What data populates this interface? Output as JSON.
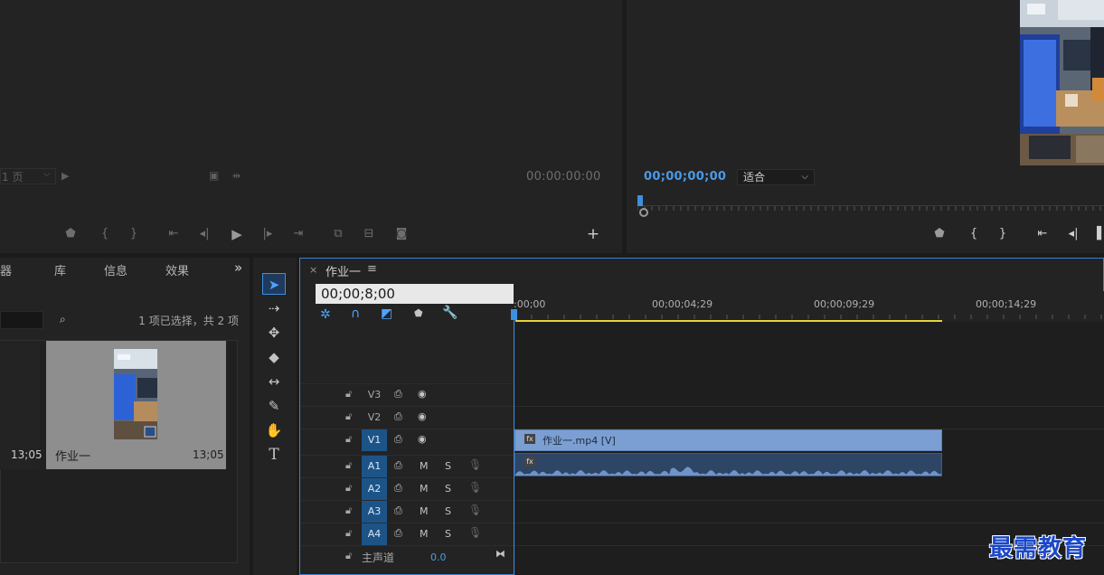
{
  "source_monitor": {
    "page_selector": "1 页",
    "timecode": "00:00:00:00"
  },
  "program_monitor": {
    "timecode": "00;00;00;00",
    "fit_label": "适合"
  },
  "project_panel": {
    "tabs": [
      "器",
      "库",
      "信息",
      "效果"
    ],
    "overflow": "»",
    "selection_info": "1 项已选择，共 2 项",
    "items": [
      {
        "name": "",
        "duration": "13;05"
      },
      {
        "name": "作业一",
        "duration": "13;05"
      }
    ]
  },
  "timeline": {
    "close": "×",
    "title": "作业一",
    "menu": "≡",
    "timecode_input": "00;00;8;00",
    "ruler_labels": [
      ":00;00",
      "00;00;04;29",
      "00;00;09;29",
      "00;00;14;29"
    ],
    "tracks": [
      {
        "name": "V3",
        "type": "video",
        "targeted": false
      },
      {
        "name": "V2",
        "type": "video",
        "targeted": false
      },
      {
        "name": "V1",
        "type": "video",
        "targeted": true
      },
      {
        "name": "A1",
        "type": "audio",
        "targeted": true
      },
      {
        "name": "A2",
        "type": "audio",
        "targeted": true
      },
      {
        "name": "A3",
        "type": "audio",
        "targeted": true
      },
      {
        "name": "A4",
        "type": "audio",
        "targeted": true
      }
    ],
    "mute_label": "M",
    "solo_label": "S",
    "video_clip_label": "作业一.mp4 [V]",
    "fx_label": "fx",
    "master": {
      "label": "主声道",
      "value": "0.0"
    }
  },
  "watermark": "最需教育",
  "colors": {
    "accent": "#3d8fe0",
    "work_area": "#e8d23a",
    "video_clip": "#7b9fd2",
    "audio_clip": "#2f4566"
  }
}
